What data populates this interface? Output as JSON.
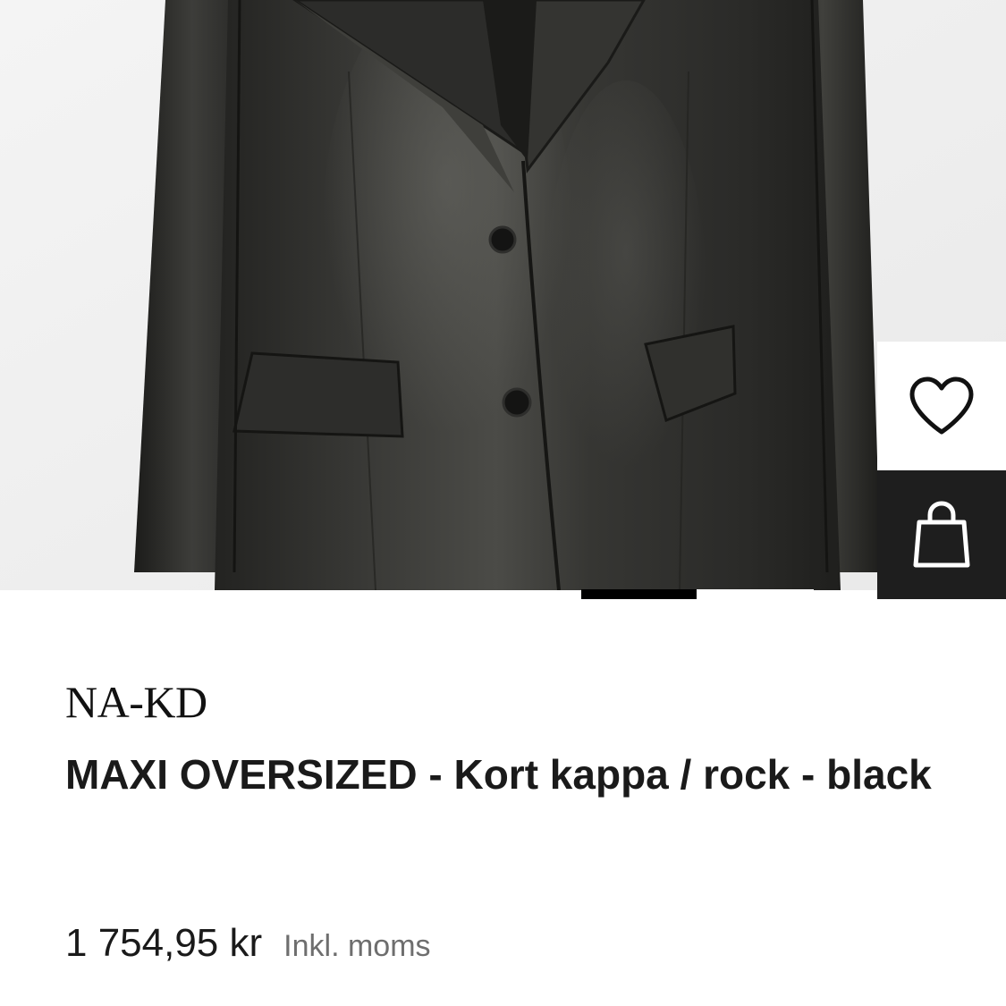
{
  "product": {
    "image_alt": "Black faux leather oversized blazer",
    "brand": "NA-KD",
    "title": "MAXI OVERSIZED - Kort kappa / rock - black",
    "price": "1 754,95 kr",
    "vat_note": "Inkl. moms"
  },
  "gallery": {
    "active_index": 1,
    "total": 2
  },
  "actions": {
    "wishlist_icon": "heart-icon",
    "bag_icon": "shopping-bag-icon"
  },
  "colors": {
    "bag_button_bg": "#1e1e1e",
    "indicator_active": "#000000",
    "text_primary": "#1a1a1a",
    "text_secondary": "#6e6e6e"
  }
}
